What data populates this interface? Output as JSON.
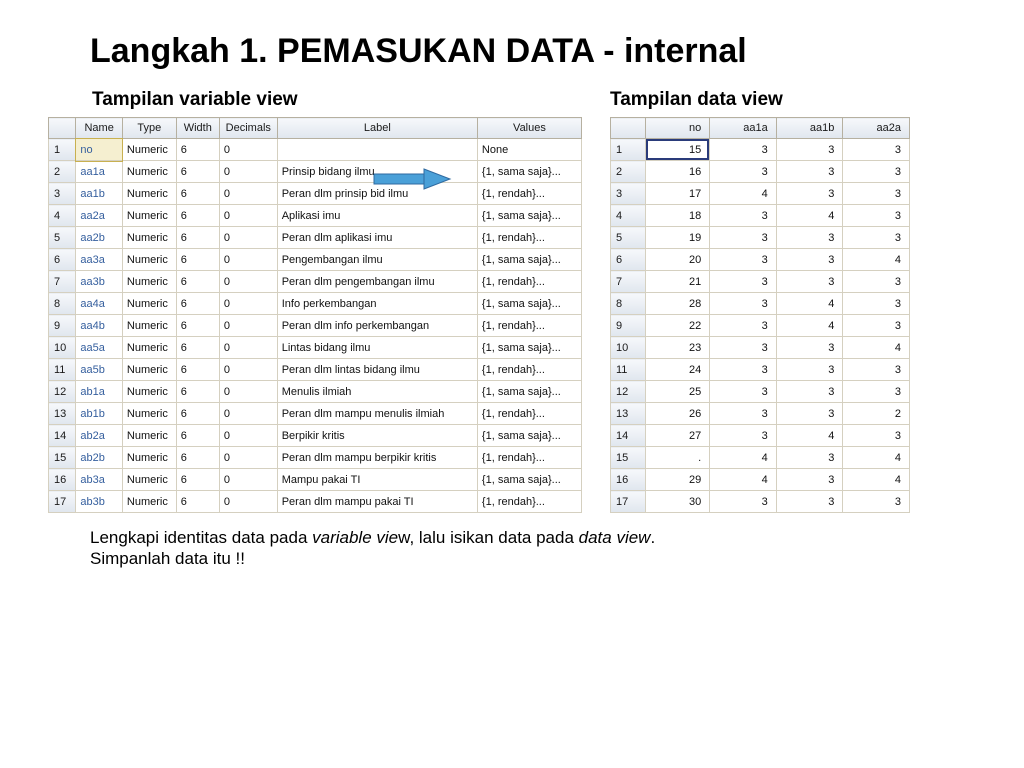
{
  "title": "Langkah 1. PEMASUKAN DATA - internal",
  "left": {
    "heading": "Tampilan variable view",
    "headers": [
      "",
      "Name",
      "Type",
      "Width",
      "Decimals",
      "Label",
      "Values"
    ],
    "rows": [
      {
        "n": "1",
        "name": "no",
        "type": "Numeric",
        "width": "6",
        "dec": "0",
        "label": "",
        "values": "None",
        "sel": true
      },
      {
        "n": "2",
        "name": "aa1a",
        "type": "Numeric",
        "width": "6",
        "dec": "0",
        "label": "Prinsip bidang ilmu",
        "values": "{1, sama saja}..."
      },
      {
        "n": "3",
        "name": "aa1b",
        "type": "Numeric",
        "width": "6",
        "dec": "0",
        "label": "Peran dlm prinsip bid ilmu",
        "values": "{1, rendah}..."
      },
      {
        "n": "4",
        "name": "aa2a",
        "type": "Numeric",
        "width": "6",
        "dec": "0",
        "label": "Aplikasi imu",
        "values": "{1, sama saja}..."
      },
      {
        "n": "5",
        "name": "aa2b",
        "type": "Numeric",
        "width": "6",
        "dec": "0",
        "label": "Peran dlm aplikasi imu",
        "values": "{1, rendah}..."
      },
      {
        "n": "6",
        "name": "aa3a",
        "type": "Numeric",
        "width": "6",
        "dec": "0",
        "label": "Pengembangan ilmu",
        "values": "{1, sama saja}..."
      },
      {
        "n": "7",
        "name": "aa3b",
        "type": "Numeric",
        "width": "6",
        "dec": "0",
        "label": "Peran dlm pengembangan ilmu",
        "values": "{1, rendah}..."
      },
      {
        "n": "8",
        "name": "aa4a",
        "type": "Numeric",
        "width": "6",
        "dec": "0",
        "label": "Info perkembangan",
        "values": "{1, sama saja}..."
      },
      {
        "n": "9",
        "name": "aa4b",
        "type": "Numeric",
        "width": "6",
        "dec": "0",
        "label": "Peran dlm info perkembangan",
        "values": "{1, rendah}..."
      },
      {
        "n": "10",
        "name": "aa5a",
        "type": "Numeric",
        "width": "6",
        "dec": "0",
        "label": "Lintas bidang ilmu",
        "values": "{1, sama saja}..."
      },
      {
        "n": "11",
        "name": "aa5b",
        "type": "Numeric",
        "width": "6",
        "dec": "0",
        "label": "Peran dlm lintas bidang ilmu",
        "values": "{1, rendah}..."
      },
      {
        "n": "12",
        "name": "ab1a",
        "type": "Numeric",
        "width": "6",
        "dec": "0",
        "label": "Menulis ilmiah",
        "values": "{1, sama saja}..."
      },
      {
        "n": "13",
        "name": "ab1b",
        "type": "Numeric",
        "width": "6",
        "dec": "0",
        "label": "Peran dlm mampu menulis ilmiah",
        "values": "{1, rendah}..."
      },
      {
        "n": "14",
        "name": "ab2a",
        "type": "Numeric",
        "width": "6",
        "dec": "0",
        "label": "Berpikir kritis",
        "values": "{1, sama saja}..."
      },
      {
        "n": "15",
        "name": "ab2b",
        "type": "Numeric",
        "width": "6",
        "dec": "0",
        "label": "Peran dlm mampu berpikir kritis",
        "values": "{1, rendah}..."
      },
      {
        "n": "16",
        "name": "ab3a",
        "type": "Numeric",
        "width": "6",
        "dec": "0",
        "label": "Mampu pakai TI",
        "values": "{1, sama saja}..."
      },
      {
        "n": "17",
        "name": "ab3b",
        "type": "Numeric",
        "width": "6",
        "dec": "0",
        "label": "Peran dlm mampu pakai TI",
        "values": "{1, rendah}..."
      }
    ]
  },
  "right": {
    "heading": "Tampilan data view",
    "headers": [
      "",
      "no",
      "aa1a",
      "aa1b",
      "aa2a"
    ],
    "rows": [
      {
        "n": "1",
        "v": [
          "15",
          "3",
          "3",
          "3"
        ],
        "sel": true
      },
      {
        "n": "2",
        "v": [
          "16",
          "3",
          "3",
          "3"
        ]
      },
      {
        "n": "3",
        "v": [
          "17",
          "4",
          "3",
          "3"
        ]
      },
      {
        "n": "4",
        "v": [
          "18",
          "3",
          "4",
          "3"
        ]
      },
      {
        "n": "5",
        "v": [
          "19",
          "3",
          "3",
          "3"
        ]
      },
      {
        "n": "6",
        "v": [
          "20",
          "3",
          "3",
          "4"
        ]
      },
      {
        "n": "7",
        "v": [
          "21",
          "3",
          "3",
          "3"
        ]
      },
      {
        "n": "8",
        "v": [
          "28",
          "3",
          "4",
          "3"
        ]
      },
      {
        "n": "9",
        "v": [
          "22",
          "3",
          "4",
          "3"
        ]
      },
      {
        "n": "10",
        "v": [
          "23",
          "3",
          "3",
          "4"
        ]
      },
      {
        "n": "11",
        "v": [
          "24",
          "3",
          "3",
          "3"
        ]
      },
      {
        "n": "12",
        "v": [
          "25",
          "3",
          "3",
          "3"
        ]
      },
      {
        "n": "13",
        "v": [
          "26",
          "3",
          "3",
          "2"
        ]
      },
      {
        "n": "14",
        "v": [
          "27",
          "3",
          "4",
          "3"
        ]
      },
      {
        "n": "15",
        "v": [
          ".",
          "4",
          "3",
          "4"
        ]
      },
      {
        "n": "16",
        "v": [
          "29",
          "4",
          "3",
          "4"
        ]
      },
      {
        "n": "17",
        "v": [
          "30",
          "3",
          "3",
          "3"
        ]
      }
    ]
  },
  "footer": {
    "t1a": "Lengkapi identitas data pada ",
    "t1b": "variable vie",
    "t1c": "w, lalu isikan data pada ",
    "t1d": "data view",
    "t1e": ".",
    "t2": "Simpanlah data itu !!"
  }
}
